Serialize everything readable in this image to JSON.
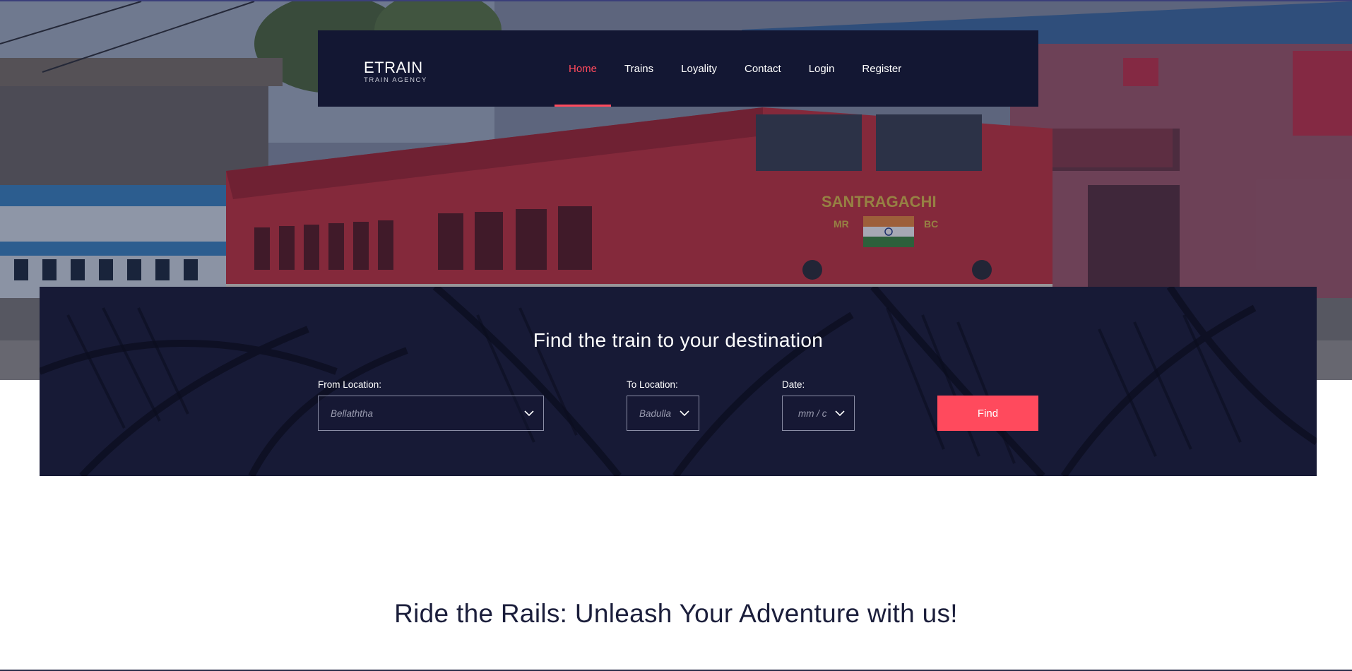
{
  "brand": {
    "title": "ETRAIN",
    "subtitle": "TRAIN AGENCY"
  },
  "nav": {
    "items": [
      {
        "label": "Home",
        "active": true
      },
      {
        "label": "Trains",
        "active": false
      },
      {
        "label": "Loyality",
        "active": false
      },
      {
        "label": "Contact",
        "active": false
      },
      {
        "label": "Login",
        "active": false
      },
      {
        "label": "Register",
        "active": false
      }
    ]
  },
  "hero": {
    "loco_name": "SANTRAGACHI",
    "loco_left": "MR",
    "loco_right": "BC"
  },
  "search": {
    "title": "Find the train to your destination",
    "from": {
      "label": "From Location:",
      "value": "Bellaththa"
    },
    "to": {
      "label": "To Location:",
      "value": "Badulla"
    },
    "date": {
      "label": "Date:",
      "placeholder": "mm/dd/yyyy",
      "value": "mm / c"
    },
    "find_label": "Find"
  },
  "tagline": "Ride the Rails: Unleash Your Adventure with us!",
  "colors": {
    "accent": "#ff4a5d",
    "navy": "#131733",
    "panel": "#171a36"
  },
  "icons": {
    "dropdown": "chevron-down-icon",
    "calendar": "calendar-icon"
  }
}
